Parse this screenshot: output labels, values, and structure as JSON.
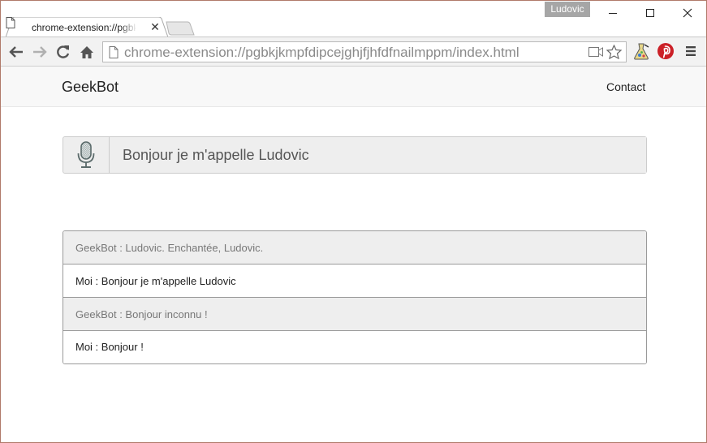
{
  "browser": {
    "profile_name": "Ludovic",
    "tab": {
      "title": "chrome-extension://pgbkjkmpfdipcejghjfjhfdfnailmppm/index.html",
      "close_glyph": "✕"
    },
    "url": "chrome-extension://pgbkjkmpfdipcejghjfjhfdfnailmppm/index.html",
    "toolbar_icons": [
      "back-arrow-icon",
      "forward-arrow-icon",
      "reload-icon",
      "home-icon"
    ],
    "extensions": [
      "extension-icon",
      "pinterest-icon"
    ]
  },
  "navbar": {
    "brand": "GeekBot",
    "contact_link": "Contact"
  },
  "speech_input": {
    "value": "Bonjour je m'appelle Ludovic",
    "icon": "microphone-icon"
  },
  "conversation": [
    {
      "speaker": "bot",
      "text": "GeekBot : Ludovic. Enchantée, Ludovic."
    },
    {
      "speaker": "me",
      "text": "Moi : Bonjour je m'appelle Ludovic"
    },
    {
      "speaker": "bot",
      "text": "GeekBot : Bonjour inconnu !"
    },
    {
      "speaker": "me",
      "text": "Moi : Bonjour !"
    }
  ],
  "colors": {
    "bot_row_bg": "#eeeeee",
    "me_row_bg": "#ffffff",
    "pinterest_red": "#cb2027"
  }
}
